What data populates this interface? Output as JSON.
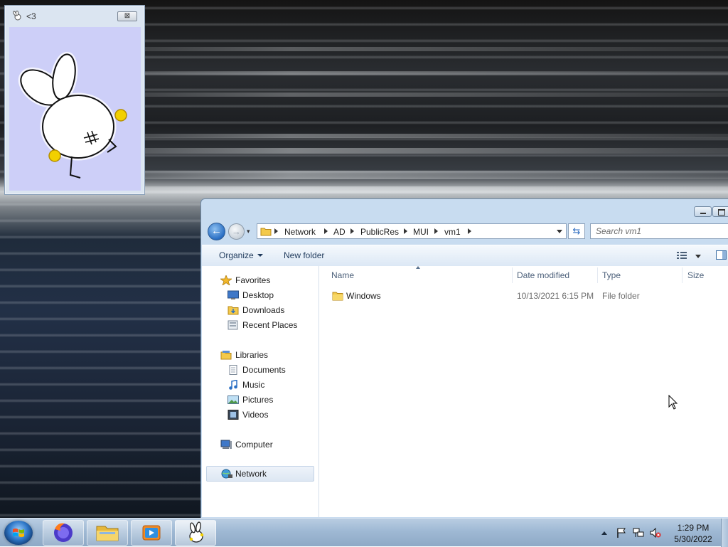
{
  "gadget": {
    "title": "<3",
    "close_glyph": "⊠"
  },
  "explorer": {
    "address": {
      "crumbs": [
        "Network",
        "AD",
        "PublicRes",
        "MUI",
        "vm1"
      ]
    },
    "search": {
      "placeholder": "Search vm1"
    },
    "toolbar": {
      "organize_label": "Organize",
      "new_folder_label": "New folder"
    },
    "nav_pane": {
      "favorites": "Favorites",
      "desktop": "Desktop",
      "downloads": "Downloads",
      "recent_places": "Recent Places",
      "libraries": "Libraries",
      "documents": "Documents",
      "music": "Music",
      "pictures": "Pictures",
      "videos": "Videos",
      "computer": "Computer",
      "network": "Network"
    },
    "columns": {
      "name": "Name",
      "date_modified": "Date modified",
      "type": "Type",
      "size": "Size"
    },
    "files": [
      {
        "name": "Windows",
        "date_modified": "10/13/2021 6:15 PM",
        "type": "File folder",
        "size": ""
      }
    ]
  },
  "taskbar": {
    "clock_time": "1:29 PM",
    "clock_date": "5/30/2022"
  },
  "colors": {
    "gadget_canvas": "#cdcff8",
    "explorer_frame": "#c8dcf0",
    "accent_blue": "#2a6fc4",
    "folder_yellow": "#f3c94b"
  }
}
